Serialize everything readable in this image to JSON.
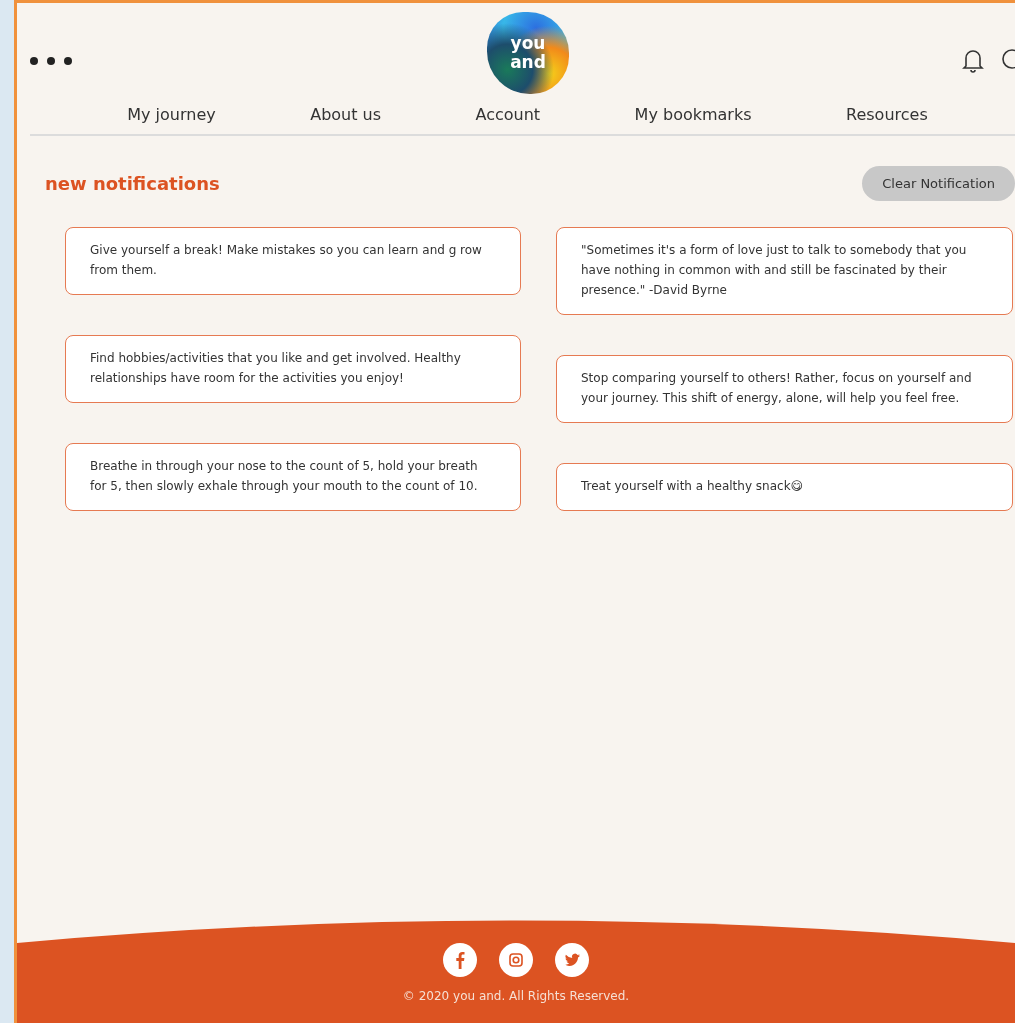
{
  "header": {
    "logo_lines": [
      "you",
      "and"
    ]
  },
  "nav": [
    {
      "label": "My journey"
    },
    {
      "label": "About us"
    },
    {
      "label": "Account"
    },
    {
      "label": "My bookmarks"
    },
    {
      "label": "Resources"
    }
  ],
  "notifications": {
    "title": "new notifications",
    "clear_button": "Clear Notification",
    "left_column": [
      "Give yourself a break! Make mistakes so you can learn and g row from them.",
      "Find hobbies/activities that you like and get involved. Healthy relationships have room for the activities you enjoy!",
      "Breathe in through your nose to the count of 5, hold your breath for 5, then slowly exhale through your mouth to the count of 10."
    ],
    "right_column": [
      "\"Sometimes it's a form of love just to talk to somebody that you have nothing in common with and still be fascinated by their presence.\" -David Byrne",
      "Stop comparing yourself to others! Rather, focus on yourself and your journey. This shift of energy, alone, will help you feel free.",
      "Treat yourself with a healthy snack😋"
    ]
  },
  "footer": {
    "copyright": "© 2020 you and. All Rights Reserved."
  }
}
